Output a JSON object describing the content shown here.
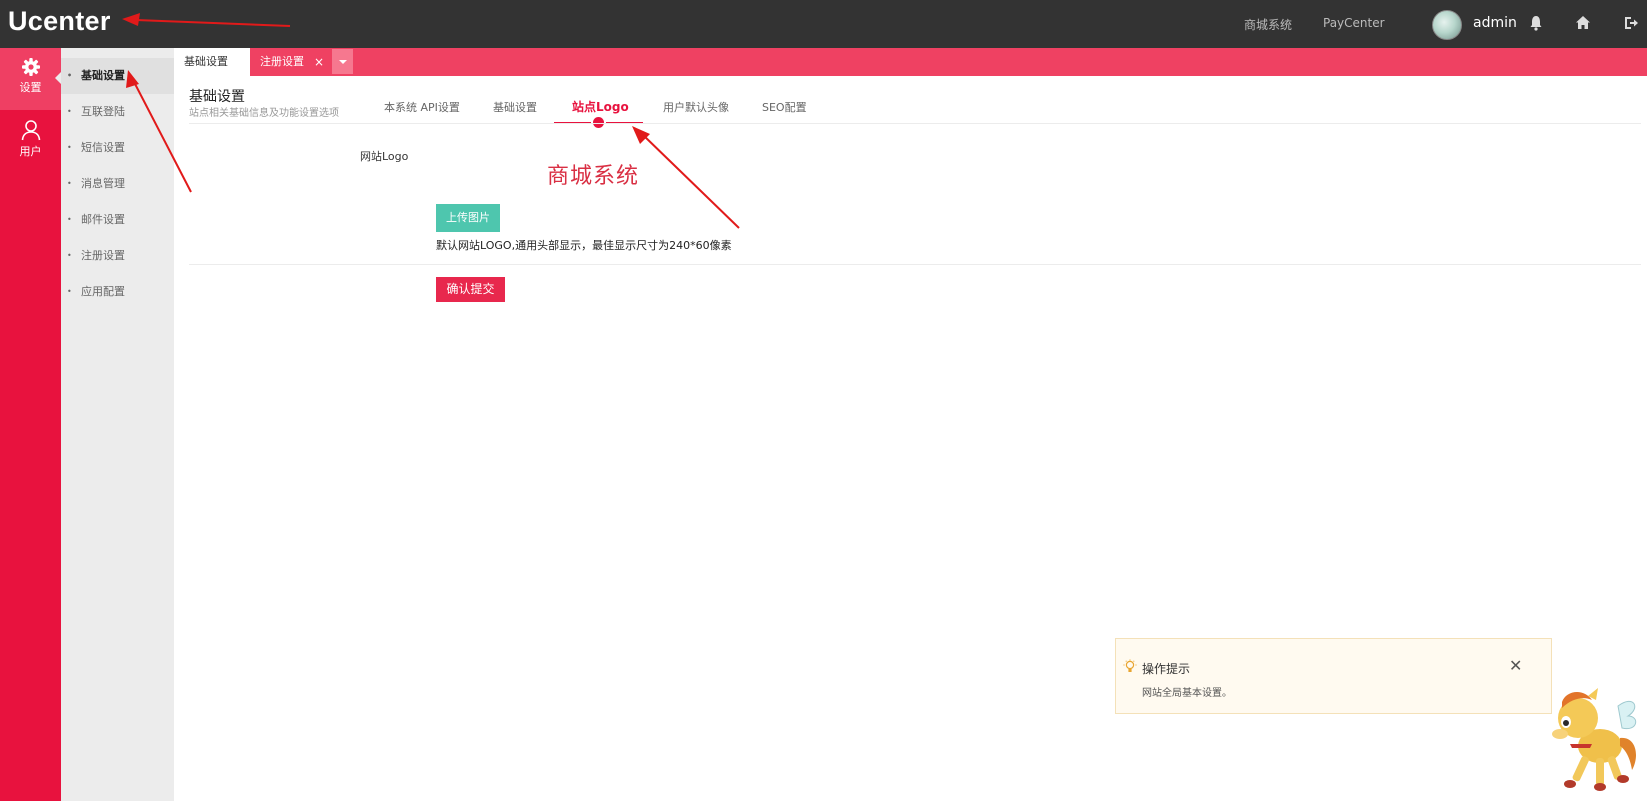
{
  "app": {
    "title": "Ucenter"
  },
  "topnav": {
    "links": [
      "商城系统",
      "PayCenter"
    ],
    "user": "admin",
    "icons": [
      "bell-icon",
      "home-icon",
      "logout-icon"
    ]
  },
  "leftbar": {
    "items": [
      {
        "label": "设置",
        "icon": "gear-icon"
      },
      {
        "label": "用户",
        "icon": "user-icon"
      }
    ]
  },
  "subnav": {
    "items": [
      "基础设置",
      "互联登陆",
      "短信设置",
      "消息管理",
      "邮件设置",
      "注册设置",
      "应用配置"
    ]
  },
  "tabs": [
    {
      "label": "基础设置"
    },
    {
      "label": "注册设置"
    }
  ],
  "page": {
    "title": "基础设置",
    "subtitle": "站点相关基础信息及功能设置选项"
  },
  "content_tabs": [
    "本系统 API设置",
    "基础设置",
    "站点Logo",
    "用户默认头像",
    "SEO配置"
  ],
  "form": {
    "logo_label": "网站Logo",
    "logo_image_text": "商城系统",
    "upload_label": "上传图片",
    "help_text": "默认网站LOGO,通用头部显示，最佳显示尺寸为240*60像素",
    "submit_label": "确认提交"
  },
  "tip": {
    "title": "操作提示",
    "body": "网站全局基本设置。"
  },
  "colors": {
    "accent": "#e8123e",
    "topbar": "#333333",
    "upload": "#4ec6ae"
  }
}
